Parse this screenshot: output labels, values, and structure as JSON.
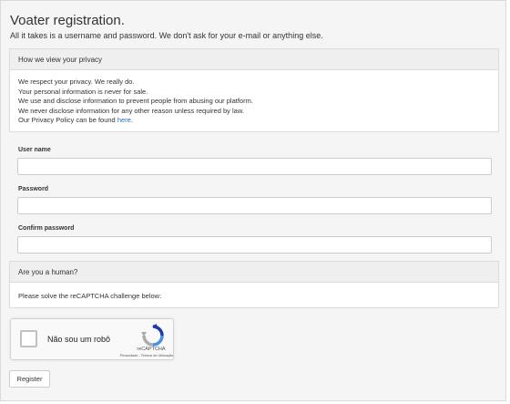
{
  "page": {
    "title": "Voater registration.",
    "subtitle": "All it takes is a username and password. We don't ask for your e-mail or anything else."
  },
  "privacy": {
    "heading": "How we view your privacy",
    "lines": [
      "We respect your privacy. We really do.",
      "Your personal information is never for sale.",
      "We use and disclose information to prevent people from abusing our platform.",
      "We never disclose information for any other reason unless required by law."
    ],
    "policy_prefix": "Our Privacy Policy can be found ",
    "policy_link": "here",
    "policy_suffix": "."
  },
  "form": {
    "username_label": "User name",
    "username_value": "",
    "password_label": "Password",
    "password_value": "",
    "confirm_label": "Confirm password",
    "confirm_value": ""
  },
  "human": {
    "heading": "Are you a human?",
    "instruction": "Please solve the reCAPTCHA challenge below:"
  },
  "recaptcha": {
    "label": "Não sou um robô",
    "brand": "reCAPTCHA",
    "links": "Privacidade - Termos de Utilização",
    "logo_icon": "recaptcha-logo-icon"
  },
  "actions": {
    "register_label": "Register"
  },
  "colors": {
    "link": "#2a6ebb",
    "panel_header": "#efefef",
    "page_background": "#f5f5f5"
  }
}
